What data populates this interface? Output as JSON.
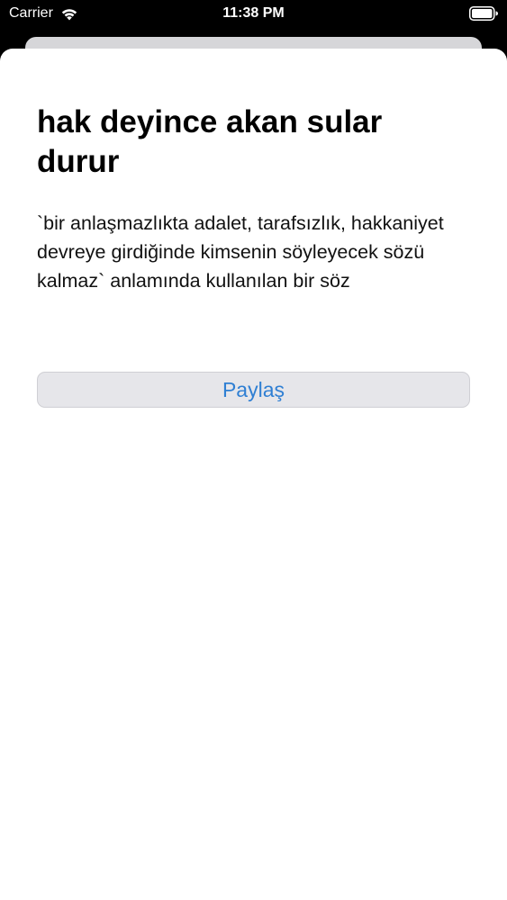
{
  "status_bar": {
    "carrier": "Carrier",
    "time": "11:38 PM",
    "icons": [
      "wifi-icon",
      "battery-icon"
    ]
  },
  "entry": {
    "title": "hak deyince akan sular durur",
    "definition": "`bir anlaşmazlıkta adalet, tarafsızlık, hakkaniyet devreye girdiğinde kimsenin söyleyecek sözü kalmaz` anlamında kullanılan bir söz"
  },
  "actions": {
    "share_label": "Paylaş"
  },
  "colors": {
    "accent": "#2f7fd3",
    "button_bg": "#e6e6ea",
    "background": "#000000",
    "sheet": "#ffffff"
  }
}
